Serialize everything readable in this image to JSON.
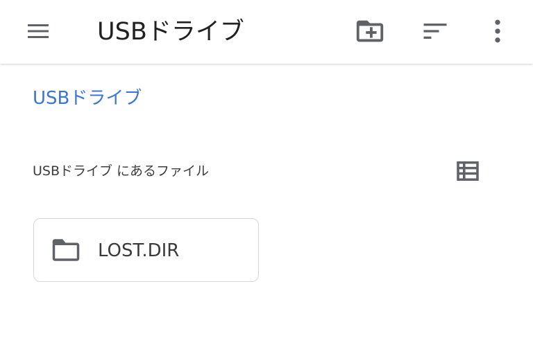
{
  "appbar": {
    "title": "USBドライブ",
    "menu_icon": "hamburger-menu-icon",
    "new_folder_icon": "create-new-folder-icon",
    "sort_icon": "sort-icon",
    "more_icon": "more-vertical-icon"
  },
  "breadcrumb": {
    "root": "USBドライブ"
  },
  "files_section": {
    "header": "USBドライブ にあるファイル",
    "view_toggle_icon": "list-view-icon"
  },
  "items": [
    {
      "name": "LOST.DIR",
      "type": "folder",
      "icon": "folder-icon"
    }
  ],
  "colors": {
    "accent": "#3a74d4",
    "icon": "#5f6368",
    "title": "#212121",
    "card_border": "#d6d6d6"
  }
}
